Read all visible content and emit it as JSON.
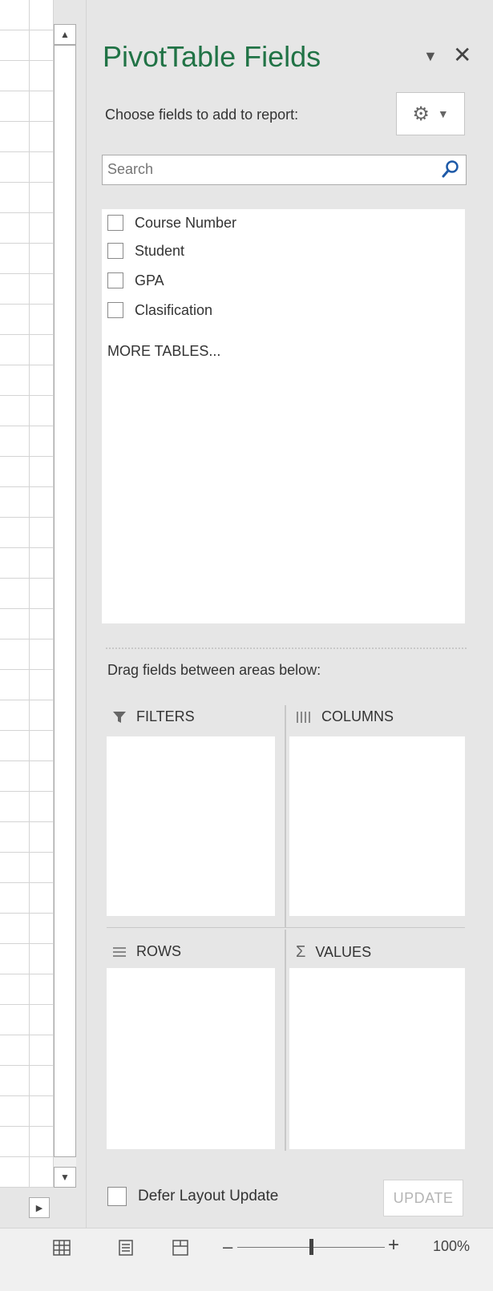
{
  "panel": {
    "title": "PivotTable Fields",
    "choose_label": "Choose fields to add to report:",
    "tools_icon": "gear-icon",
    "title_dropdown_icon": "dropdown-arrow-icon",
    "close_icon": "close-icon"
  },
  "search": {
    "placeholder": "Search",
    "icon": "search-icon"
  },
  "fields": [
    {
      "label": "Course Number",
      "checked": false
    },
    {
      "label": "Student",
      "checked": false
    },
    {
      "label": "GPA",
      "checked": false
    },
    {
      "label": "Clasification",
      "checked": false
    }
  ],
  "more_tables": "MORE TABLES...",
  "areas": {
    "drag_label": "Drag fields between areas below:",
    "filters": {
      "label": "FILTERS",
      "icon": "filter-icon"
    },
    "columns": {
      "label": "COLUMNS",
      "icon": "columns-icon"
    },
    "rows": {
      "label": "ROWS",
      "icon": "rows-icon"
    },
    "values": {
      "label": "VALUES",
      "icon": "sigma-icon"
    }
  },
  "footer": {
    "defer_label": "Defer Layout Update",
    "update_label": "UPDATE"
  },
  "statusbar": {
    "zoom_level": "100%",
    "zoom_fraction": 0.5
  },
  "colors": {
    "accent": "#217346",
    "panel_bg": "#e6e6e6"
  }
}
